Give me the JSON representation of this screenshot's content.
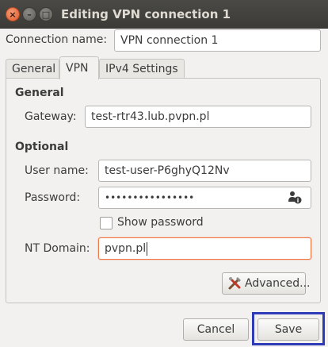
{
  "window": {
    "title": "Editing VPN connection 1",
    "close_glyph": "×",
    "minimize_glyph": "–",
    "maximize_glyph": "□"
  },
  "connection_name": {
    "label": "Connection name:",
    "value": "VPN connection 1"
  },
  "tabs": [
    {
      "label": "General",
      "active": false
    },
    {
      "label": "VPN",
      "active": true
    },
    {
      "label": "IPv4 Settings",
      "active": false
    }
  ],
  "general_section": {
    "heading": "General",
    "gateway_label": "Gateway:",
    "gateway_value": "test-rtr43.lub.pvpn.pl"
  },
  "optional_section": {
    "heading": "Optional",
    "username_label": "User name:",
    "username_value": "test-user-P6ghyQ12Nv",
    "password_label": "Password:",
    "password_value": "••••••••••••••••",
    "password_icon": "user-info-icon",
    "show_password_label": "Show password",
    "show_password_checked": false,
    "nt_domain_label": "NT Domain:",
    "nt_domain_value": "pvpn.pl"
  },
  "advanced_button": {
    "label": "Advanced...",
    "icon": "tools-icon"
  },
  "footer": {
    "cancel_label": "Cancel",
    "save_label": "Save"
  },
  "colors": {
    "titlebar": "#3c3b37",
    "close_button": "#e05a2b",
    "focus_border": "#f07746",
    "highlight_box": "#2e3ab7"
  }
}
